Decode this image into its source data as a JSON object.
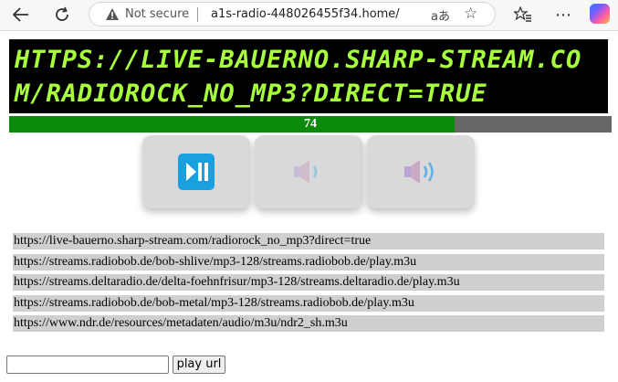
{
  "browser": {
    "security_label": "Not secure",
    "address": "a1s-radio-448026455f34.home/",
    "translate_glyph": "aあ",
    "back_icon": "back-arrow-icon",
    "reload_icon": "reload-icon"
  },
  "player": {
    "display_text": "https://live-bauerno.sharp-stream.com/radiorock_no_mp3?direct=true",
    "volume": 74,
    "volume_label": "74",
    "volume_max": 100,
    "colors": {
      "display_bg": "#000000",
      "display_text": "#a8ff3c",
      "volume_fill": "#0a8a0a",
      "volume_track": "#666666",
      "play_button": "#1aa0e0"
    },
    "buttons": [
      {
        "name": "play-pause-button",
        "icon": "play-pause-icon"
      },
      {
        "name": "volume-down-button",
        "icon": "speaker-low-icon"
      },
      {
        "name": "volume-up-button",
        "icon": "speaker-high-icon"
      }
    ]
  },
  "stations": [
    "https://live-bauerno.sharp-stream.com/radiorock_no_mp3?direct=true",
    "https://streams.radiobob.de/bob-shlive/mp3-128/streams.radiobob.de/play.m3u",
    "https://streams.deltaradio.de/delta-foehnfrisur/mp3-128/streams.deltaradio.de/play.m3u",
    "https://streams.radiobob.de/bob-metal/mp3-128/streams.radiobob.de/play.m3u",
    "https://www.ndr.de/resources/metadaten/audio/m3u/ndr2_sh.m3u"
  ],
  "url_form": {
    "input_value": "",
    "play_label": "play url"
  }
}
